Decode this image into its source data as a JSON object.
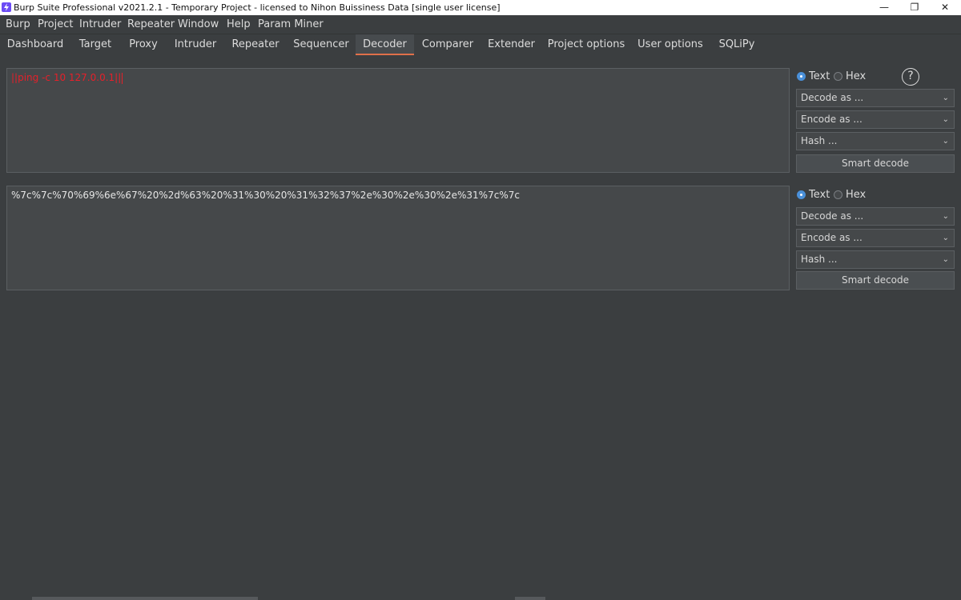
{
  "window": {
    "title": "Burp Suite Professional v2021.2.1 - Temporary Project - licensed to Nihon Buissiness Data [single user license]",
    "minimize": "—",
    "restore": "❐",
    "close": "✕"
  },
  "menu": [
    "Burp",
    "Project",
    "Intruder",
    "Repeater",
    "Window",
    "Help",
    "Param Miner"
  ],
  "tabs": [
    "Dashboard",
    "Target",
    "Proxy",
    "Intruder",
    "Repeater",
    "Sequencer",
    "Decoder",
    "Comparer",
    "Extender",
    "Project options",
    "User options",
    "SQLiPy"
  ],
  "active_tab": "Decoder",
  "panels": [
    {
      "content": "||ping -c 10 127.0.0.1||",
      "mode_text": "Text",
      "mode_hex": "Hex",
      "selected_mode": "Text",
      "decode_label": "Decode as ...",
      "encode_label": "Encode as ...",
      "hash_label": "Hash ...",
      "smart_label": "Smart decode"
    },
    {
      "content": "%7c%7c%70%69%6e%67%20%2d%63%20%31%30%20%31%32%37%2e%30%2e%30%2e%31%7c%7c",
      "mode_text": "Text",
      "mode_hex": "Hex",
      "selected_mode": "Text",
      "decode_label": "Decode as ...",
      "encode_label": "Encode as ...",
      "hash_label": "Hash ...",
      "smart_label": "Smart decode"
    }
  ],
  "help": "?",
  "colors": {
    "accent": "#e0704a",
    "input_text": "#e5202a",
    "radio_selected": "#4a90d9"
  }
}
